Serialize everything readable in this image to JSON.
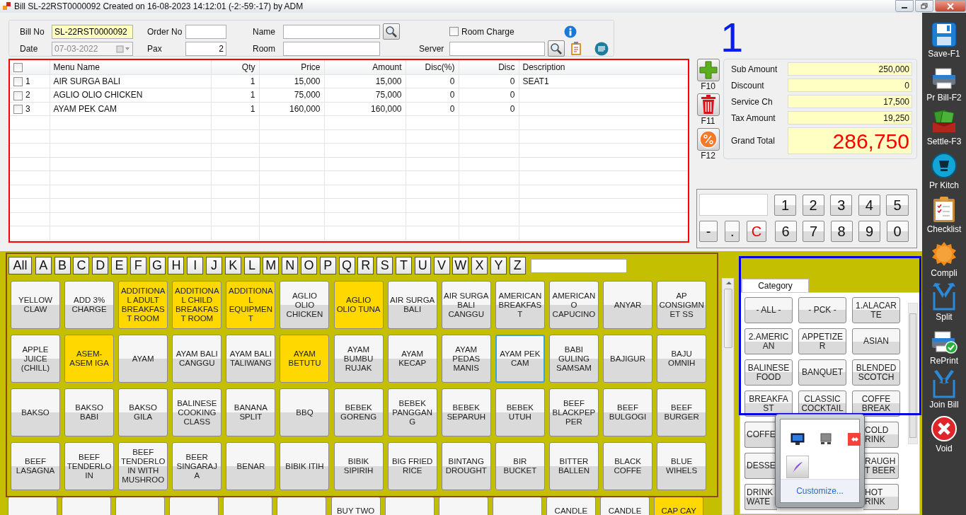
{
  "window": {
    "title": "Bill SL-22RST0000092 Created on 16-08-2023 14:12:01 (-2:-59:-17) by ADM"
  },
  "header": {
    "bill_no": {
      "label": "Bill No",
      "value": "SL-22RST0000092"
    },
    "date": {
      "label": "Date",
      "value": "07-03-2022",
      "disabled": true
    },
    "order_no": {
      "label": "Order No"
    },
    "pax": {
      "label": "Pax",
      "value": "2"
    },
    "name": {
      "label": "Name"
    },
    "room": {
      "label": "Room"
    },
    "room_charge": {
      "label": "Room Charge",
      "checked": false
    },
    "server": {
      "label": "Server"
    }
  },
  "table_number": "1",
  "order_table": {
    "all_checked": false,
    "columns": [
      "Menu Name",
      "Qty",
      "Price",
      "Amount",
      "Disc(%)",
      "Disc",
      "Description"
    ],
    "rows": [
      {
        "no": "1",
        "checked": false,
        "menu_name": "AIR SURGA BALI",
        "qty": "1",
        "price": "15,000",
        "amount": "15,000",
        "disc_pct": "0",
        "disc": "0",
        "description": "SEAT1"
      },
      {
        "no": "2",
        "checked": false,
        "menu_name": "AGLIO OLIO  CHICKEN",
        "qty": "1",
        "price": "75,000",
        "amount": "75,000",
        "disc_pct": "0",
        "disc": "0"
      },
      {
        "no": "3",
        "checked": false,
        "menu_name": "AYAM PEK CAM",
        "qty": "1",
        "price": "160,000",
        "amount": "160,000",
        "disc_pct": "0",
        "disc": "0"
      }
    ]
  },
  "side_buttons": [
    {
      "key": "F10",
      "kind": "add"
    },
    {
      "key": "F11",
      "kind": "delete"
    },
    {
      "key": "F12",
      "kind": "discount"
    }
  ],
  "totals": [
    {
      "label": "Sub Amount",
      "value": "250,000",
      "kind": "line"
    },
    {
      "label": "Discount",
      "value": "0",
      "kind": "line"
    },
    {
      "label": "Service Ch",
      "value": "17,500",
      "kind": "line"
    },
    {
      "label": "Tax Amount",
      "value": "19,250",
      "kind": "line"
    },
    {
      "label": "Grand Total",
      "value": "286,750",
      "kind": "grand"
    }
  ],
  "numpad": [
    {
      "key": "1",
      "kind": "digit"
    },
    {
      "key": "2",
      "kind": "digit"
    },
    {
      "key": "3",
      "kind": "digit"
    },
    {
      "key": "4",
      "kind": "digit"
    },
    {
      "key": "5",
      "kind": "digit"
    },
    {
      "key": "-",
      "kind": "minus"
    },
    {
      "key": ".",
      "kind": "dot"
    },
    {
      "key": "C",
      "kind": "clear"
    },
    {
      "key": "6",
      "kind": "digit"
    },
    {
      "key": "7",
      "kind": "digit"
    },
    {
      "key": "8",
      "kind": "digit"
    },
    {
      "key": "9",
      "kind": "digit"
    },
    {
      "key": "0",
      "kind": "digit"
    }
  ],
  "letter_bar": [
    "All",
    "A",
    "B",
    "C",
    "D",
    "E",
    "F",
    "G",
    "H",
    "I",
    "J",
    "K",
    "L",
    "M",
    "N",
    "O",
    "P",
    "Q",
    "R",
    "S",
    "T",
    "U",
    "V",
    "W",
    "X",
    "Y",
    "Z"
  ],
  "menu_items": [
    {
      "label": "YELLOW CLAW",
      "highlighted": false,
      "selected": false
    },
    {
      "label": "ADD 3% CHARGE",
      "highlighted": false,
      "selected": false
    },
    {
      "label": "ADDITIONAL ADULT BREAKFAST ROOM",
      "highlighted": true,
      "selected": false
    },
    {
      "label": "ADDITIONAL CHILD BREAKFAST ROOM",
      "highlighted": true,
      "selected": false
    },
    {
      "label": "ADDITIONAL EQUIPMENT",
      "highlighted": true,
      "selected": false
    },
    {
      "label": "AGLIO OLIO CHICKEN",
      "highlighted": false,
      "selected": false
    },
    {
      "label": "AGLIO OLIO TUNA",
      "highlighted": true,
      "selected": false
    },
    {
      "label": "AIR SURGA BALI",
      "highlighted": false,
      "selected": false
    },
    {
      "label": "AIR SURGA BALI CANGGU",
      "highlighted": false,
      "selected": false
    },
    {
      "label": "AMERICAN BREAKFAST",
      "highlighted": false,
      "selected": false
    },
    {
      "label": "AMERICANO CAPUCINO",
      "highlighted": false,
      "selected": false
    },
    {
      "label": "ANYAR",
      "highlighted": false,
      "selected": false
    },
    {
      "label": "AP CONSIGMNET SS",
      "highlighted": false,
      "selected": false
    },
    {
      "label": "APPLE JUICE (CHILL)",
      "highlighted": false,
      "selected": false
    },
    {
      "label": "ASEM-ASEM IGA",
      "highlighted": true,
      "selected": false
    },
    {
      "label": "AYAM",
      "highlighted": false,
      "selected": false
    },
    {
      "label": "AYAM BALI CANGGU",
      "highlighted": false,
      "selected": false
    },
    {
      "label": "AYAM BALI TALIWANG",
      "highlighted": false,
      "selected": false
    },
    {
      "label": "AYAM BETUTU",
      "highlighted": true,
      "selected": false
    },
    {
      "label": "AYAM BUMBU RUJAK",
      "highlighted": false,
      "selected": false
    },
    {
      "label": "AYAM KECAP",
      "highlighted": false,
      "selected": false
    },
    {
      "label": "AYAM PEDAS MANIS",
      "highlighted": false,
      "selected": false
    },
    {
      "label": "AYAM PEK CAM",
      "highlighted": false,
      "selected": true
    },
    {
      "label": "BABI GULING SAMSAM",
      "highlighted": false,
      "selected": false
    },
    {
      "label": "BAJIGUR",
      "highlighted": false,
      "selected": false
    },
    {
      "label": "BAJU OMNIH",
      "highlighted": false,
      "selected": false
    },
    {
      "label": "BAKSO",
      "highlighted": false,
      "selected": false
    },
    {
      "label": "BAKSO BABI",
      "highlighted": false,
      "selected": false
    },
    {
      "label": "BAKSO GILA",
      "highlighted": false,
      "selected": false
    },
    {
      "label": "BALINESE COOKING CLASS",
      "highlighted": false,
      "selected": false
    },
    {
      "label": "BANANA SPLIT",
      "highlighted": false,
      "selected": false
    },
    {
      "label": "BBQ",
      "highlighted": false,
      "selected": false
    },
    {
      "label": "BEBEK GORENG",
      "highlighted": false,
      "selected": false
    },
    {
      "label": "BEBEK PANGGANG",
      "highlighted": false,
      "selected": false
    },
    {
      "label": "BEBEK SEPARUH",
      "highlighted": false,
      "selected": false
    },
    {
      "label": "BEBEK UTUH",
      "highlighted": false,
      "selected": false
    },
    {
      "label": "BEEF BLACKPEPPER",
      "highlighted": false,
      "selected": false
    },
    {
      "label": "BEEF BULGOGI",
      "highlighted": false,
      "selected": false
    },
    {
      "label": "BEEF BURGER",
      "highlighted": false,
      "selected": false
    },
    {
      "label": "BEEF LASAGNA",
      "highlighted": false,
      "selected": false
    },
    {
      "label": "BEEF TENDERLOIN",
      "highlighted": false,
      "selected": false
    },
    {
      "label": "BEEF TENDERLOIN WITH MUSHROO",
      "highlighted": false,
      "selected": false
    },
    {
      "label": "BEER SINGARAJA",
      "highlighted": false,
      "selected": false
    },
    {
      "label": "BENAR",
      "highlighted": false,
      "selected": false
    },
    {
      "label": "BIBIK ITIH",
      "highlighted": false,
      "selected": false
    },
    {
      "label": "BIBIK SIPIRIH",
      "highlighted": false,
      "selected": false
    },
    {
      "label": "BIG FRIED RICE",
      "highlighted": false,
      "selected": false
    },
    {
      "label": "BINTANG DROUGHT",
      "highlighted": false,
      "selected": false
    },
    {
      "label": "BIR BUCKET",
      "highlighted": false,
      "selected": false
    },
    {
      "label": "BITTER BALLEN",
      "highlighted": false,
      "selected": false
    },
    {
      "label": "BLACK COFFE",
      "highlighted": false,
      "selected": false
    },
    {
      "label": "BLUE WIHELS",
      "highlighted": false,
      "selected": false
    },
    {
      "highlighted": false,
      "selected": false
    },
    {
      "highlighted": false,
      "selected": false
    },
    {
      "highlighted": false,
      "selected": false
    },
    {
      "highlighted": false,
      "selected": false
    },
    {
      "highlighted": false,
      "selected": false
    },
    {
      "highlighted": false,
      "selected": false
    },
    {
      "label": "BUY TWO",
      "highlighted": false,
      "selected": false
    },
    {
      "highlighted": false,
      "selected": false
    },
    {
      "highlighted": false,
      "selected": false
    },
    {
      "highlighted": false,
      "selected": false
    },
    {
      "label": "CANDLE",
      "highlighted": false,
      "selected": false
    },
    {
      "label": "CANDLE",
      "highlighted": false,
      "selected": false
    },
    {
      "label": "CAP CAY",
      "highlighted": true,
      "selected": false
    }
  ],
  "categories": {
    "tab": "Category",
    "items": [
      "- ALL -",
      "- PCK -",
      "1.ALACARTE",
      "2.AMERICAN",
      "APPETIZER",
      "ASIAN",
      "BALINESE FOOD",
      "BANQUET",
      "BLENDED SCOTCH",
      "BREAKFAST",
      "CLASSIC COCKTAIL",
      "COFFE BREAK"
    ],
    "partly_hidden": [
      {
        "left": "COFFE",
        "right": "COLD RINK"
      },
      {
        "left": "DESSE",
        "right": "RAUGHT BEER"
      },
      {
        "left": "DRINK WATE",
        "right": "HOT RINK"
      }
    ]
  },
  "tray_popup": {
    "icons": [
      {
        "kind": "monitor",
        "selected": false
      },
      {
        "kind": "device",
        "selected": false
      },
      {
        "kind": "red",
        "selected": false
      },
      {
        "kind": "feather",
        "selected": true
      }
    ],
    "link": "Customize..."
  },
  "toolbar": [
    {
      "label": "Save-F1",
      "kind": "save"
    },
    {
      "label": "Pr Bill-F2",
      "kind": "printer"
    },
    {
      "label": "Settle-F3",
      "kind": "money"
    },
    {
      "label": "Pr Kitch",
      "kind": "kitchen"
    },
    {
      "label": "Checklist",
      "kind": "checklist"
    },
    {
      "label": "Compli",
      "kind": "free"
    },
    {
      "label": "Split",
      "kind": "split"
    },
    {
      "label": "RePrint",
      "kind": "reprint"
    },
    {
      "label": "Join Bill",
      "kind": "join"
    },
    {
      "label": "Void",
      "kind": "void"
    }
  ]
}
